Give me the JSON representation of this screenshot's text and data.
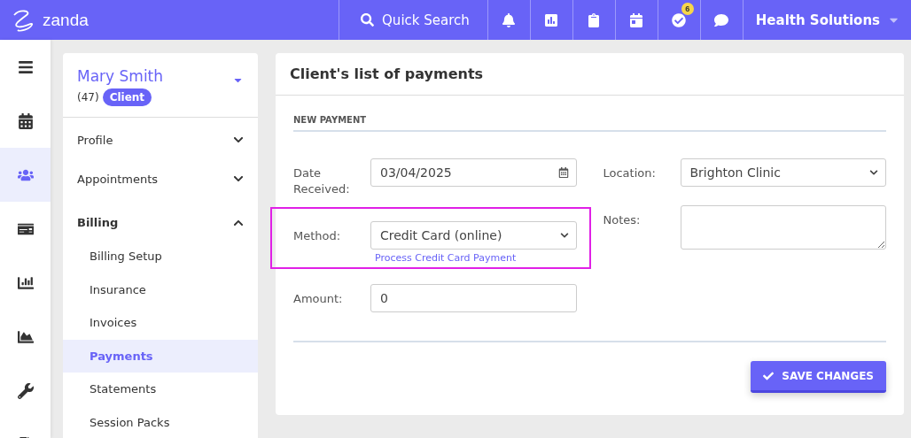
{
  "topbar": {
    "brand": "zanda",
    "search": "Quick Search",
    "badge": "6",
    "account": "Health Solutions"
  },
  "rail": [
    {
      "selected": false
    },
    {
      "selected": false
    },
    {
      "selected": true
    },
    {
      "selected": false
    },
    {
      "selected": false
    },
    {
      "selected": false
    },
    {
      "selected": false
    },
    {
      "selected": false
    }
  ],
  "client": {
    "name": "Mary Smith",
    "count": "(47)",
    "tag": "Client"
  },
  "menu": [
    {
      "label": "Profile",
      "expanded": false
    },
    {
      "label": "Appointments",
      "expanded": false
    },
    {
      "label": "Billing",
      "expanded": true,
      "children": [
        {
          "label": "Billing Setup",
          "selected": false
        },
        {
          "label": "Insurance",
          "selected": false
        },
        {
          "label": "Invoices",
          "selected": false
        },
        {
          "label": "Payments",
          "selected": true
        },
        {
          "label": "Statements",
          "selected": false
        },
        {
          "label": "Session Packs",
          "selected": false
        }
      ]
    }
  ],
  "page": {
    "title": "Client's list of payments",
    "section": "NEW PAYMENT",
    "date": {
      "label": "Date Received:",
      "value": "03/04/2025"
    },
    "method": {
      "label": "Method:",
      "value": "Credit Card (online)",
      "link": "Process Credit Card Payment",
      "highlighted": true
    },
    "amount": {
      "label": "Amount:",
      "value": "0"
    },
    "location": {
      "label": "Location:",
      "value": "Brighton Clinic"
    },
    "notes": {
      "label": "Notes:"
    },
    "save": "SAVE CHANGES"
  }
}
